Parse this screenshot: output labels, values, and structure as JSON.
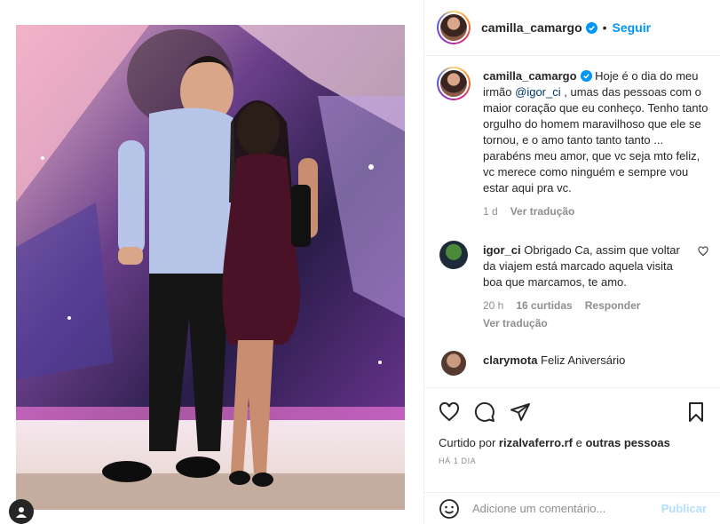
{
  "header": {
    "username": "camilla_camargo",
    "separator": "•",
    "follow_label": "Seguir"
  },
  "caption": {
    "username": "camilla_camargo",
    "text_before_mention": " Hoje é o dia do meu irmão ",
    "mention": "@igor_ci",
    "text_after_mention": " , umas das pessoas com o maior coração que eu conheço. Tenho tanto orgulho do homem maravilhoso que ele se tornou, e o amo tanto tanto tanto ... parabéns meu amor, que vc seja mto feliz, vc merece como ninguém e sempre vou estar aqui pra vc.",
    "time": "1 d",
    "translate_label": "Ver tradução"
  },
  "comments": [
    {
      "username": "igor_ci",
      "text": " Obrigado Ca, assim que voltar da viajem está marcado aquela visita boa que marcamos, te amo.",
      "time": "20 h",
      "likes": "16 curtidas",
      "reply_label": "Responder",
      "translate_label": "Ver tradução"
    },
    {
      "username": "clarymota",
      "text": " Feliz Aniversário"
    }
  ],
  "likes": {
    "prefix": "Curtido por ",
    "user": "rizalvaferro.rf",
    "middle": " e ",
    "others": "outras pessoas"
  },
  "date": "HÁ 1 DIA",
  "add_comment": {
    "placeholder": "Adicione um comentário...",
    "publish_label": "Publicar"
  },
  "icons": {
    "like": "heart-icon",
    "comment": "comment-icon",
    "share": "send-icon",
    "save": "bookmark-icon",
    "emoji": "emoji-icon",
    "verified": "verified-badge-icon"
  },
  "colors": {
    "accent": "#0095f6",
    "mention": "#00376b",
    "muted": "#8e8e8e",
    "publish_disabled": "#b2dffc"
  }
}
